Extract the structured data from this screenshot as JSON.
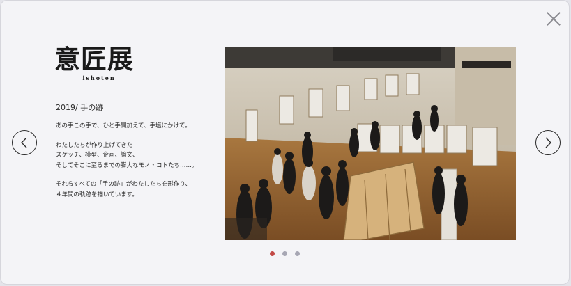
{
  "logo": {
    "main": "意匠展",
    "sub": "ishoten"
  },
  "year_title": "2019/ 手の跡",
  "description": {
    "p1": "あの手この手で、ひと手間加えて、手塩にかけて。",
    "p2": [
      "わたしたちが作り上げてきた",
      "スケッチ、模型、企画、論文、",
      "そしてそこに至るまでの膨大なモノ・コトたち……。"
    ],
    "p3": [
      "それらすべての「手の跡」がわたしたちを形作り、",
      "４年間の軌跡を描いています。"
    ]
  },
  "carousel": {
    "total": 3,
    "active_index": 0
  },
  "colors": {
    "active_dot": "#c24a47",
    "inactive_dot": "#a7a7b4"
  },
  "icons": {
    "close": "close-icon",
    "prev": "chevron-left-icon",
    "next": "chevron-right-icon"
  }
}
